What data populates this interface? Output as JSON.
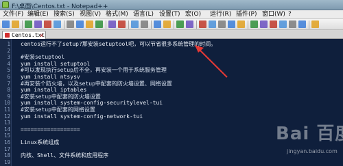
{
  "window": {
    "title": "F:\\桌面\\Centos.txt - Notepad++"
  },
  "menu": [
    {
      "label": "文件(F)",
      "icon": "file-menu"
    },
    {
      "label": "编辑(E)",
      "icon": "edit-menu"
    },
    {
      "label": "搜索(S)",
      "icon": "search-menu"
    },
    {
      "label": "视图(V)",
      "icon": "view-menu"
    },
    {
      "label": "格式(M)",
      "icon": "format-menu"
    },
    {
      "label": "语言(L)",
      "icon": "language-menu"
    },
    {
      "label": "设置(T)",
      "icon": "settings-menu"
    },
    {
      "label": "宏(O)",
      "icon": "macro-menu"
    },
    {
      "label": "运行(R)",
      "icon": "run-menu"
    },
    {
      "label": "插件(P)",
      "icon": "plugins-menu"
    },
    {
      "label": "窗口(W)",
      "icon": "window-menu"
    },
    {
      "label": "?",
      "icon": "help-menu"
    }
  ],
  "toolbar": {
    "buttons": [
      "new-file-icon",
      "open-file-icon",
      "save-icon",
      "save-all-icon",
      "close-icon",
      "close-all-icon",
      "print-icon",
      "cut-icon",
      "copy-icon",
      "paste-icon",
      "undo-icon",
      "redo-icon",
      "find-icon",
      "replace-icon",
      "zoom-in-icon",
      "zoom-out-icon",
      "sync-v-icon",
      "sync-h-icon",
      "word-wrap-icon",
      "all-chars-icon",
      "indent-guide-icon",
      "language-icon",
      "doc-map-icon",
      "function-list-icon",
      "record-macro-icon",
      "stop-record-icon",
      "play-macro-icon",
      "run-macro-icon",
      "save-macro-icon",
      "spellcheck-icon"
    ],
    "accent": "#4a90d9"
  },
  "tab": {
    "label": "Centos.txt",
    "icon": "document-red-icon",
    "close": "x"
  },
  "editor": {
    "background": "#0f1f3c",
    "lines": [
      {
        "n": "1",
        "text": "centos运行不了setup?那安装setuptool吧，可以节省很多系统管理的时间。"
      },
      {
        "n": "2",
        "text": ""
      },
      {
        "n": "3",
        "text": "#安装setuptool"
      },
      {
        "n": "4",
        "text": "yum install setuptool"
      },
      {
        "n": "5",
        "text": "#可以发现执行setup后不全，再安装一个用于系统服务管理"
      },
      {
        "n": "6",
        "text": "yum install ntsysv"
      },
      {
        "n": "7",
        "text": "#再安装个防火墙，以及setup中配套的防火墙设置、网络设置"
      },
      {
        "n": "8",
        "text": "yum install iptables"
      },
      {
        "n": "9",
        "text": "#安装setup中配套的防火墙设置"
      },
      {
        "n": "10",
        "text": "yum install system-config-securitylevel-tui"
      },
      {
        "n": "11",
        "text": "#安装setup中配套的网络设置"
      },
      {
        "n": "12",
        "text": "yum install system-config-network-tui"
      },
      {
        "n": "13",
        "text": ""
      },
      {
        "n": "14",
        "text": "=================="
      },
      {
        "n": "15",
        "text": ""
      },
      {
        "n": "16",
        "text": "Linux系统组成"
      },
      {
        "n": "17",
        "text": ""
      },
      {
        "n": "18",
        "text": "内核、Shell、文件系统和应用程序"
      },
      {
        "n": "19",
        "text": ""
      }
    ]
  },
  "annotation": {
    "arrow_color": "#e53935"
  },
  "watermark": {
    "big": "Bai 百度",
    "small": "jingyan.baidu.com"
  }
}
